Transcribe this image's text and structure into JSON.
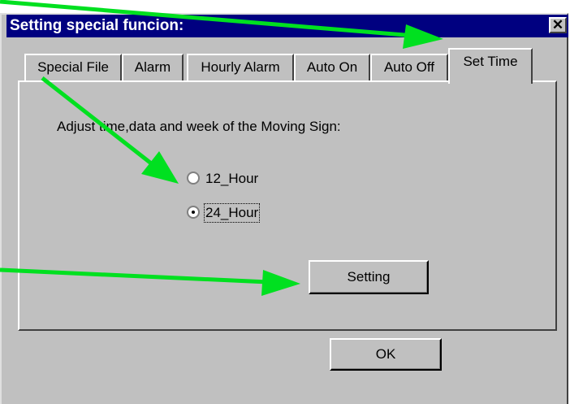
{
  "window": {
    "title": "Setting special funcion:",
    "close_glyph": "✕"
  },
  "tabs": [
    {
      "label": "Special File"
    },
    {
      "label": "Alarm"
    },
    {
      "label": "Hourly Alarm"
    },
    {
      "label": "Auto On"
    },
    {
      "label": "Auto Off"
    },
    {
      "label": "Set Time",
      "active": true
    }
  ],
  "panel": {
    "instruction": "Adjust time,data and week of the Moving Sign:",
    "radio_options": [
      {
        "label": "12_Hour",
        "selected": false
      },
      {
        "label": "24_Hour",
        "selected": true
      }
    ],
    "setting_button": "Setting"
  },
  "footer": {
    "ok_button": "OK"
  },
  "colors": {
    "titlebar": "#000080",
    "dialog_face": "#c0c0c0",
    "annotation_arrow": "#00e020"
  }
}
